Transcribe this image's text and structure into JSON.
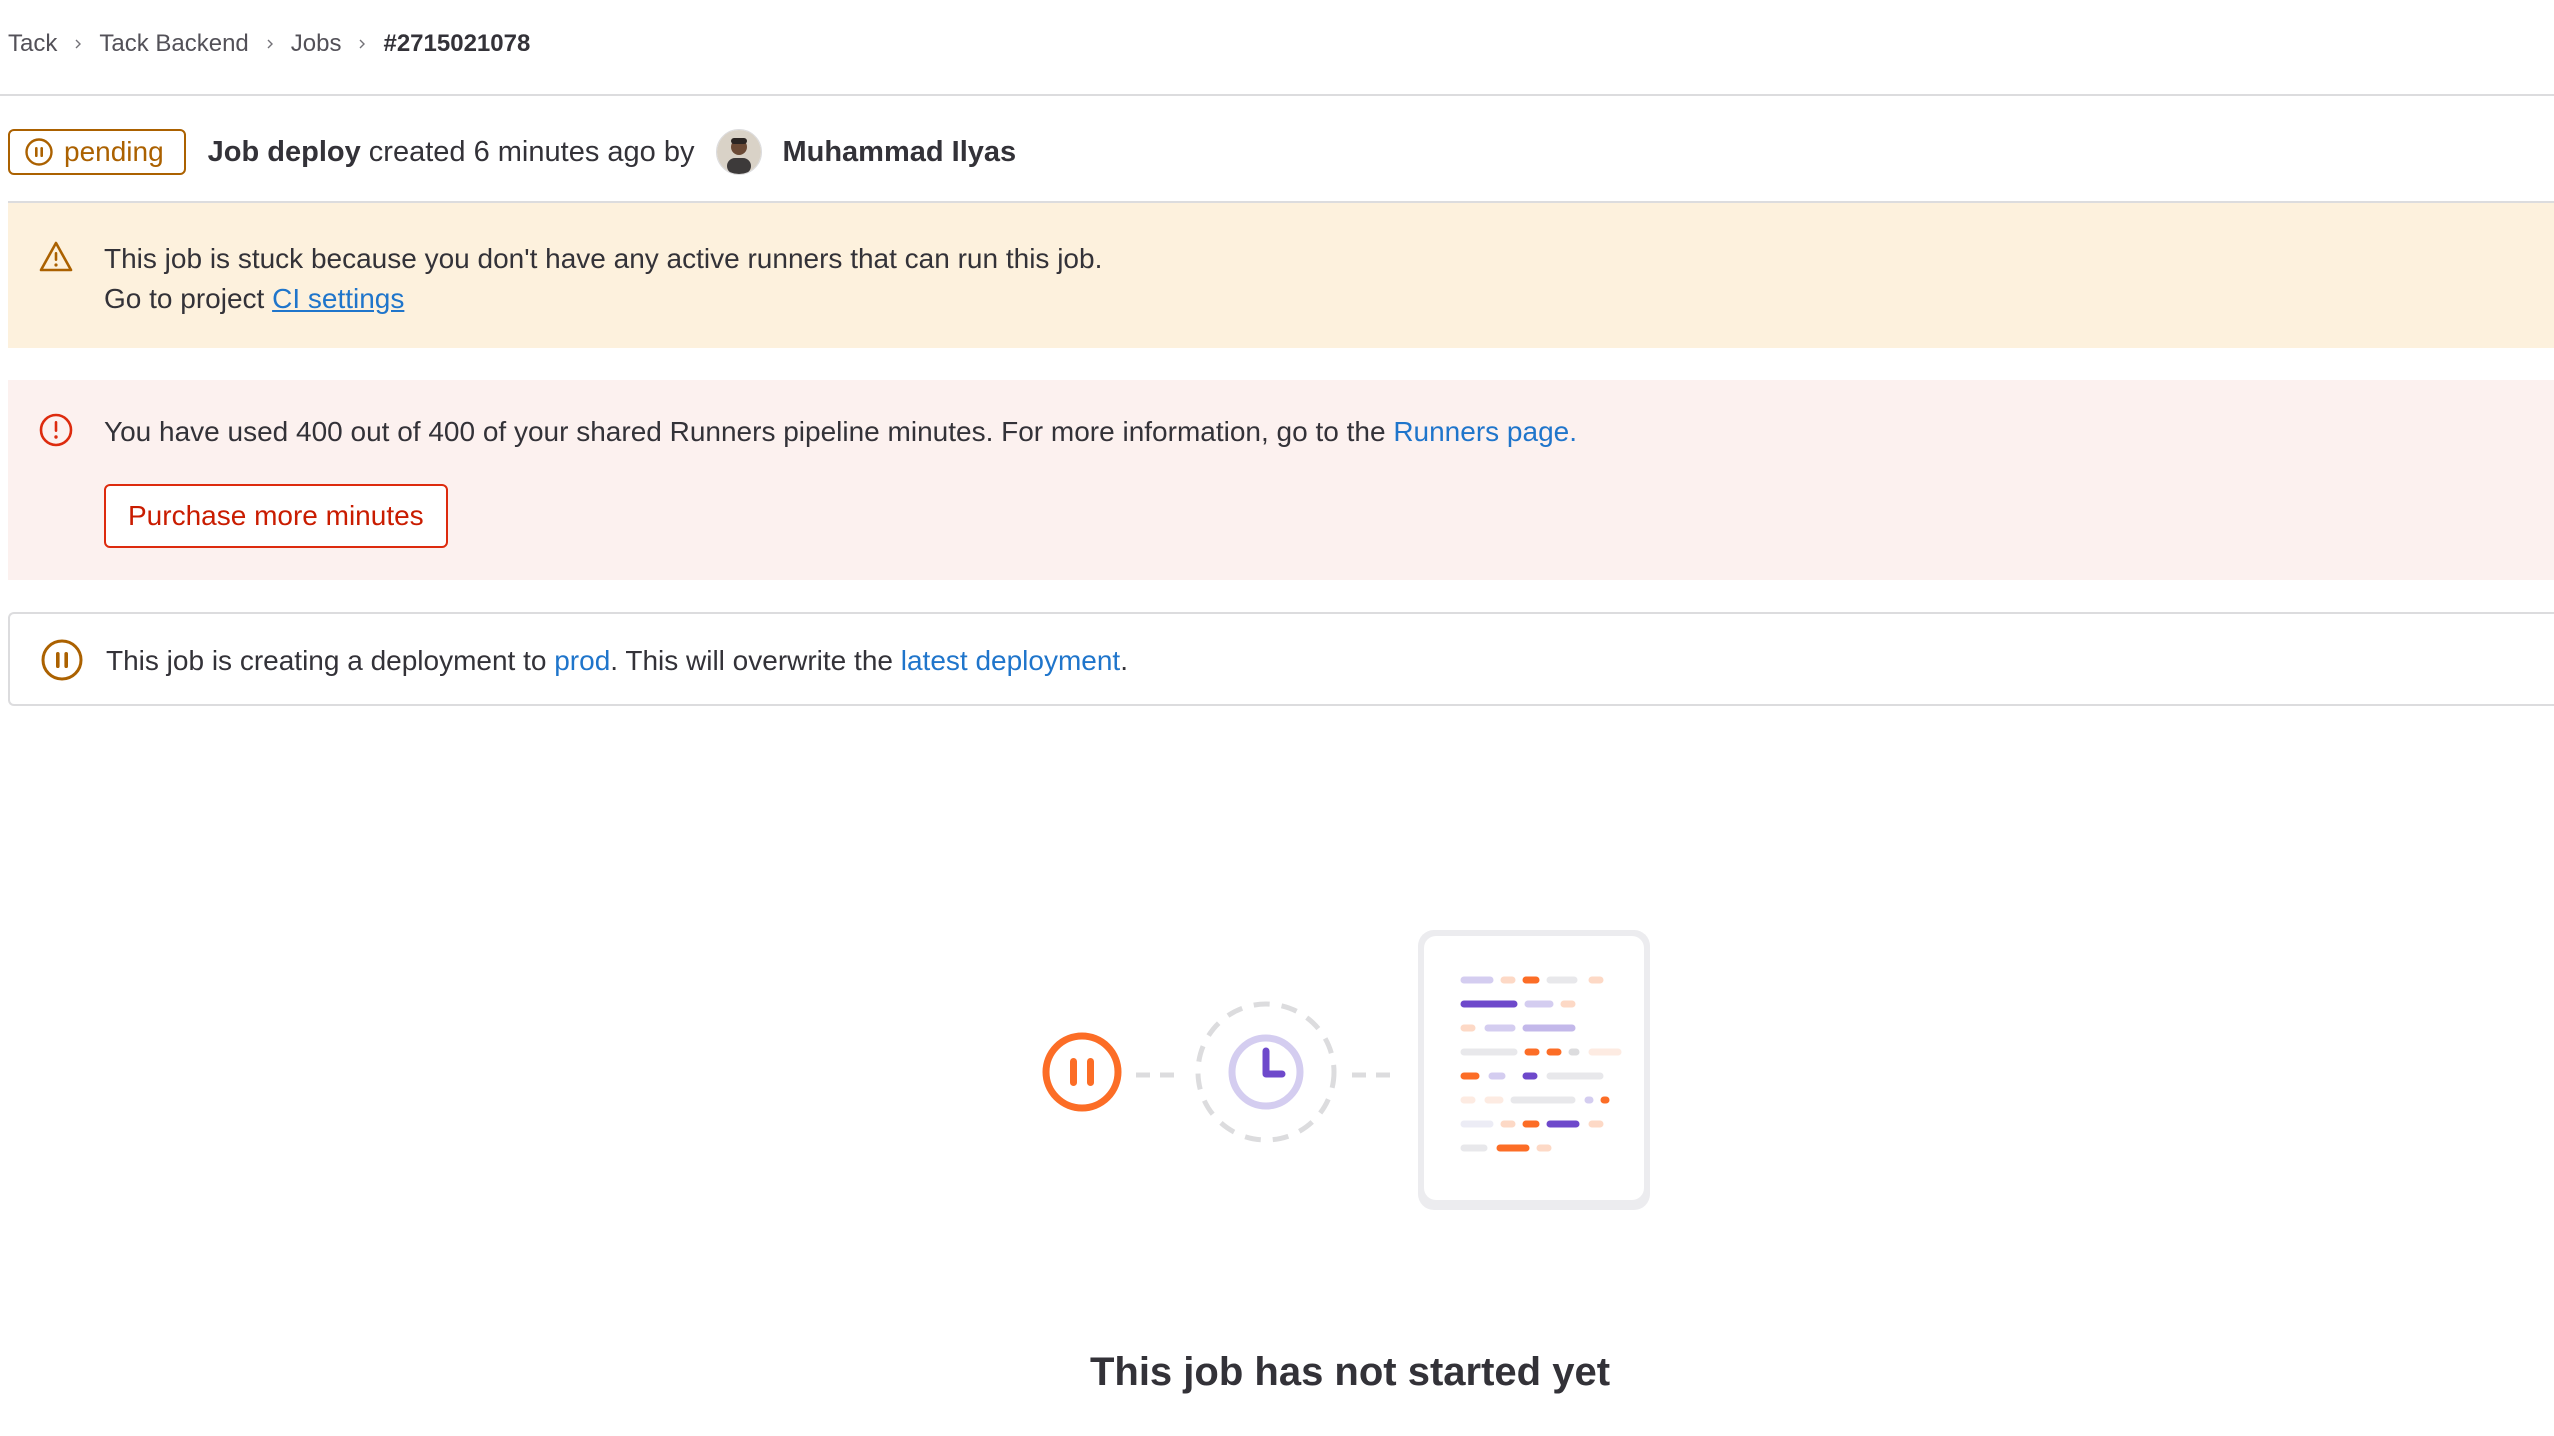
{
  "breadcrumb": {
    "items": [
      {
        "label": "Tack"
      },
      {
        "label": "Tack Backend"
      },
      {
        "label": "Jobs"
      },
      {
        "label": "#2715021078"
      }
    ]
  },
  "header": {
    "status": "pending",
    "job_prefix": "Job ",
    "job_name": "deploy",
    "created_text": " created 6 minutes ago by",
    "user_name": "Muhammad Ilyas"
  },
  "stuck_alert": {
    "line1": "This job is stuck because you don't have any active runners that can run this job.",
    "line2_prefix": "Go to project ",
    "link_label": "CI settings"
  },
  "minutes_alert": {
    "message": "You have used 400 out of 400 of your shared Runners pipeline minutes. For more information, go to the ",
    "link_label": "Runners page.",
    "button_label": "Purchase more minutes"
  },
  "deployment_info": {
    "prefix": "This job is creating a deployment to ",
    "environment": "prod",
    "middle": ". This will overwrite the ",
    "link_label": "latest deployment",
    "suffix": "."
  },
  "empty_state": {
    "title": "This job has not started yet"
  },
  "colors": {
    "pending": "#ab6100",
    "warning_bg": "#fdf1dd",
    "danger_bg": "#fcf1ef",
    "danger": "#dd2b0e",
    "link": "#1f75cb",
    "illustration_orange": "#fc6d26",
    "illustration_purple": "#6e49cb"
  },
  "icons": {
    "breadcrumb_separator": "chevron-right-icon",
    "status": "status-pending-icon",
    "warning": "warning-icon",
    "error": "error-icon",
    "deployment": "status-pending-icon"
  }
}
